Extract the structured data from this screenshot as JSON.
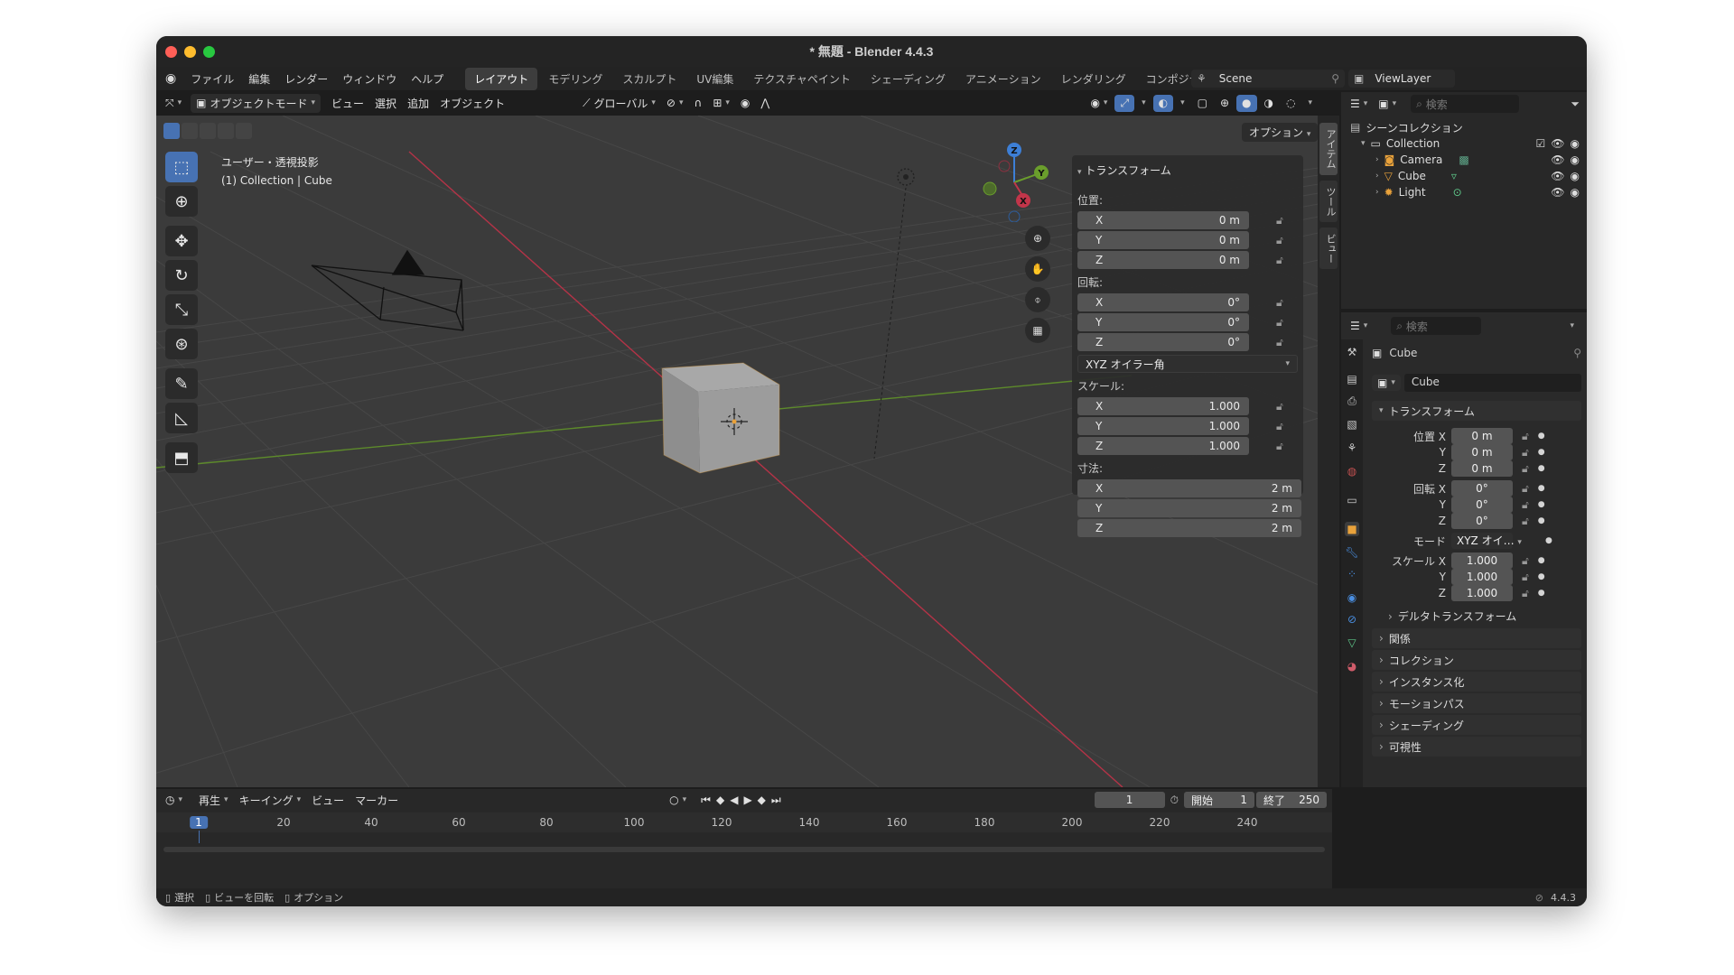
{
  "window": {
    "title": "* 無題 - Blender 4.4.3"
  },
  "menu": [
    "ファイル",
    "編集",
    "レンダー",
    "ウィンドウ",
    "ヘルプ"
  ],
  "workspaces": [
    "レイアウト",
    "モデリング",
    "スカルプト",
    "UV編集",
    "テクスチャペイント",
    "シェーディング",
    "アニメーション",
    "レンダリング",
    "コンポジティング"
  ],
  "active_workspace": "レイアウト",
  "scene": "Scene",
  "view_layer": "ViewLayer",
  "viewport_header": {
    "mode": "オブジェクトモード",
    "menus": [
      "ビュー",
      "選択",
      "追加",
      "オブジェクト"
    ],
    "orientation": "グローバル",
    "options": "オプション"
  },
  "viewport": {
    "view_name": "ユーザー・透視投影",
    "context": "(1) Collection | Cube"
  },
  "gizmo": {
    "x": "X",
    "y": "Y",
    "z": "Z"
  },
  "npanel": {
    "title": "トランスフォーム",
    "location_label": "位置:",
    "location": [
      {
        "axis": "X",
        "value": "0 m"
      },
      {
        "axis": "Y",
        "value": "0 m"
      },
      {
        "axis": "Z",
        "value": "0 m"
      }
    ],
    "rotation_label": "回転:",
    "rotation": [
      {
        "axis": "X",
        "value": "0°"
      },
      {
        "axis": "Y",
        "value": "0°"
      },
      {
        "axis": "Z",
        "value": "0°"
      }
    ],
    "rotation_mode": "XYZ オイラー角",
    "scale_label": "スケール:",
    "scale": [
      {
        "axis": "X",
        "value": "1.000"
      },
      {
        "axis": "Y",
        "value": "1.000"
      },
      {
        "axis": "Z",
        "value": "1.000"
      }
    ],
    "dimensions_label": "寸法:",
    "dimensions": [
      {
        "axis": "X",
        "value": "2 m"
      },
      {
        "axis": "Y",
        "value": "2 m"
      },
      {
        "axis": "Z",
        "value": "2 m"
      }
    ]
  },
  "side_tabs": [
    "アイテム",
    "ツール",
    "ビュー"
  ],
  "outliner": {
    "search_placeholder": "検索",
    "scene_collection": "シーンコレクション",
    "collection": "Collection",
    "items": [
      "Camera",
      "Cube",
      "Light"
    ]
  },
  "properties": {
    "search_placeholder": "検索",
    "object_name": "Cube",
    "data_name": "Cube",
    "transform_title": "トランスフォーム",
    "loc_label": "位置 X",
    "loc": [
      "0 m",
      "0 m",
      "0 m"
    ],
    "rot_label": "回転 X",
    "rot": [
      "0°",
      "0°",
      "0°"
    ],
    "mode_label": "モード",
    "mode_value": "XYZ オイ…",
    "scale_label": "スケール X",
    "scale": [
      "1.000",
      "1.000",
      "1.000"
    ],
    "y": "Y",
    "z": "Z",
    "delta": "デルタトランスフォーム",
    "sections": [
      "関係",
      "コレクション",
      "インスタンス化",
      "モーションパス",
      "シェーディング",
      "可視性"
    ]
  },
  "timeline": {
    "menus": [
      "再生",
      "キーイング",
      "ビュー",
      "マーカー"
    ],
    "current_frame": "1",
    "start_label": "開始",
    "start": "1",
    "end_label": "終了",
    "end": "250",
    "ruler": [
      "1",
      "20",
      "40",
      "60",
      "80",
      "100",
      "120",
      "140",
      "160",
      "180",
      "200",
      "220",
      "240"
    ]
  },
  "statusbar": {
    "items": [
      "選択",
      "ビューを回転",
      "オプション"
    ],
    "version": "4.4.3"
  },
  "colors": {
    "accent": "#4772b3",
    "x_axis": "#c2354a",
    "y_axis": "#6a9e2c",
    "z_axis": "#3d7fd6",
    "selection": "#e9a23b"
  }
}
